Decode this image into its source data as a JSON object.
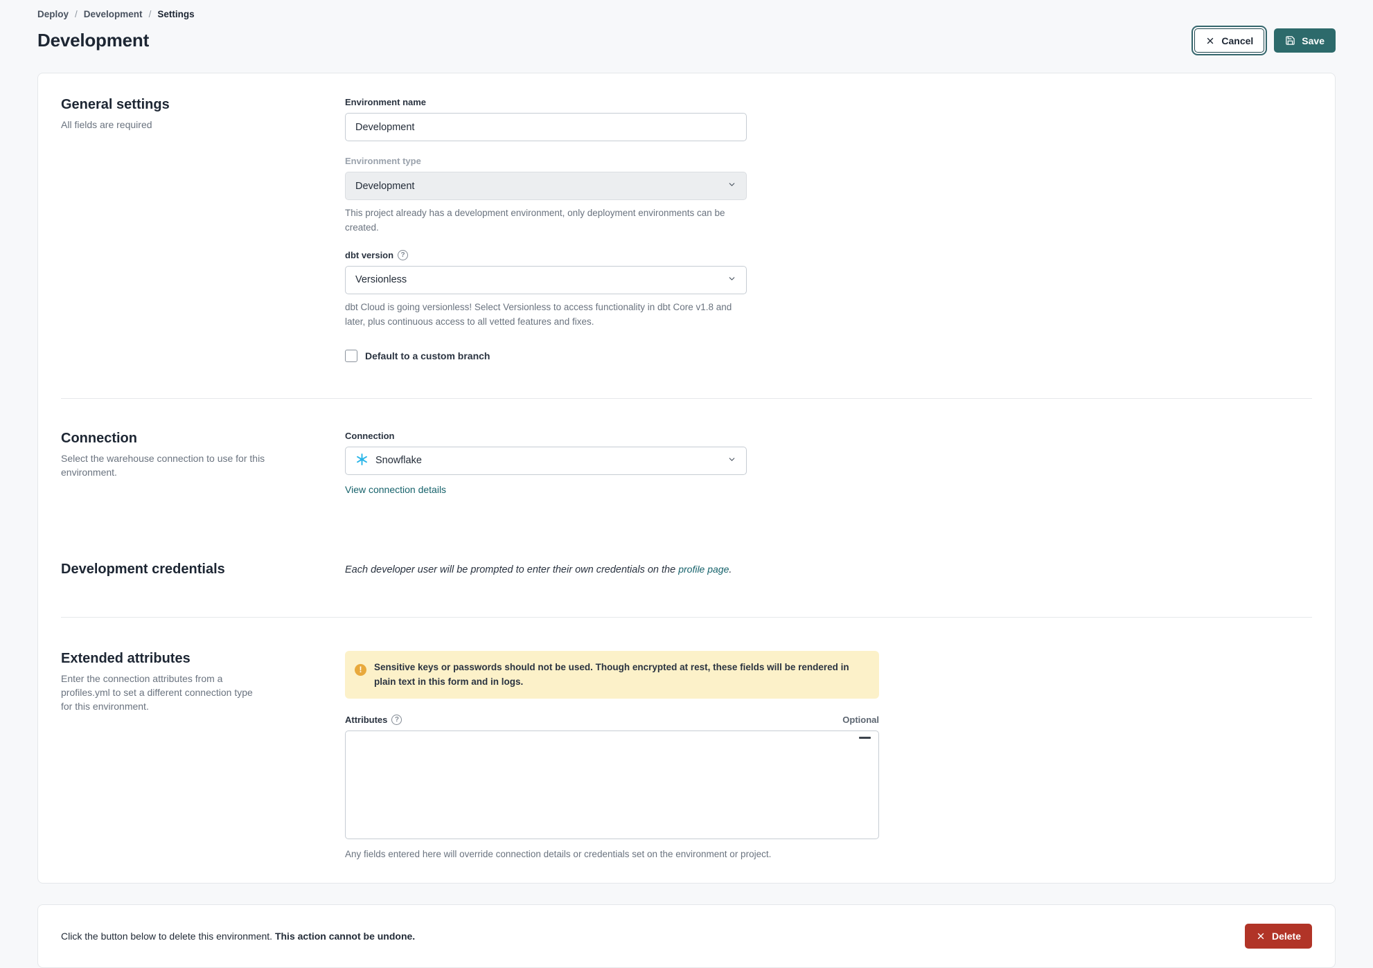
{
  "breadcrumb": {
    "separator": "/",
    "items": [
      {
        "label": "Deploy"
      },
      {
        "label": "Development"
      },
      {
        "label": "Settings"
      }
    ]
  },
  "header": {
    "title": "Development",
    "cancel_label": "Cancel",
    "save_label": "Save"
  },
  "general": {
    "heading": "General settings",
    "subheading": "All fields are required",
    "environment_name": {
      "label": "Environment name",
      "value": "Development"
    },
    "environment_type": {
      "label": "Environment type",
      "value": "Development",
      "help": "This project already has a development environment, only deployment environments can be created."
    },
    "dbt_version": {
      "label": "dbt version",
      "value": "Versionless",
      "help": "dbt Cloud is going versionless! Select Versionless to access functionality in dbt Core v1.8 and later, plus continuous access to all vetted features and fixes."
    },
    "custom_branch": {
      "label": "Default to a custom branch",
      "checked": false
    }
  },
  "connection": {
    "heading": "Connection",
    "subheading": "Select the warehouse connection to use for this environment.",
    "field_label": "Connection",
    "value": "Snowflake",
    "link_label": "View connection details"
  },
  "credentials": {
    "heading": "Development credentials",
    "note_prefix": "Each developer user will be prompted to enter their own credentials on the ",
    "note_link": "profile page",
    "note_suffix": "."
  },
  "extended": {
    "heading": "Extended attributes",
    "subheading": "Enter the connection attributes from a profiles.yml to set a different connection type for this environment.",
    "warning": "Sensitive keys or passwords should not be used. Though encrypted at rest, these fields will be rendered in plain text in this form and in logs.",
    "attributes_label": "Attributes",
    "optional_label": "Optional",
    "textarea_value": "",
    "help": "Any fields entered here will override connection details or credentials set on the environment or project."
  },
  "danger": {
    "text_prefix": "Click the button below to delete this environment. ",
    "text_bold": "This action cannot be undone.",
    "delete_label": "Delete"
  },
  "icons": {
    "cancel": "x-icon",
    "save": "floppy-disk-icon",
    "connection": "snowflake-icon",
    "delete": "x-icon",
    "help": "?"
  },
  "colors": {
    "accent_teal": "#2d6a6b",
    "link_teal": "#16626b",
    "danger_red": "#b13427",
    "warning_bg": "#fcf1c9",
    "warning_icon_orange": "#e8a93c",
    "snowflake_blue": "#29b5e8",
    "page_bg": "#f7f8fa"
  }
}
